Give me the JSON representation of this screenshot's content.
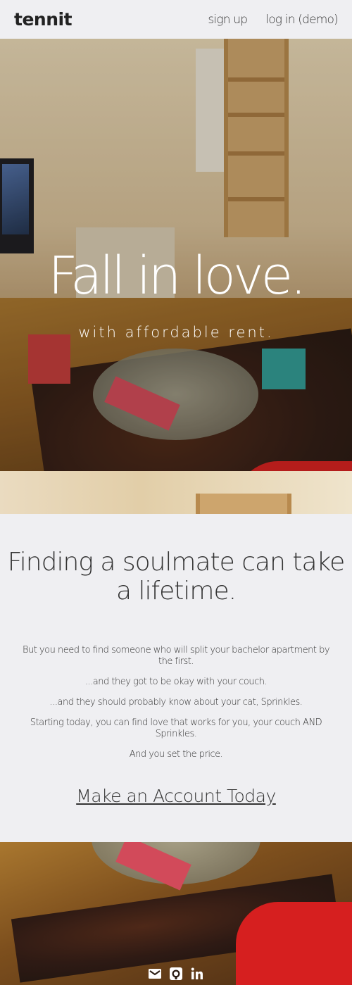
{
  "navbar": {
    "brand": "tennit",
    "links": {
      "signup": "sign up",
      "login": "log in (demo)"
    }
  },
  "hero": {
    "title": "Fall in love.",
    "subtitle": "with affordable rent."
  },
  "content": {
    "headline": "Finding a soulmate can take a lifetime.",
    "paragraphs": [
      "But you need to find someone who will split your bachelor apartment by the first.",
      "...and they got to be okay with your couch.",
      "...and they should probably know about your cat, Sprinkles.",
      "Starting today, you can find love that works for you, your couch AND Sprinkles.",
      "And you set the price."
    ],
    "cta": "Make an Account Today"
  },
  "footer": {
    "social": [
      {
        "icon": "envelope-icon"
      },
      {
        "icon": "github-icon"
      },
      {
        "icon": "linkedin-icon"
      }
    ]
  }
}
